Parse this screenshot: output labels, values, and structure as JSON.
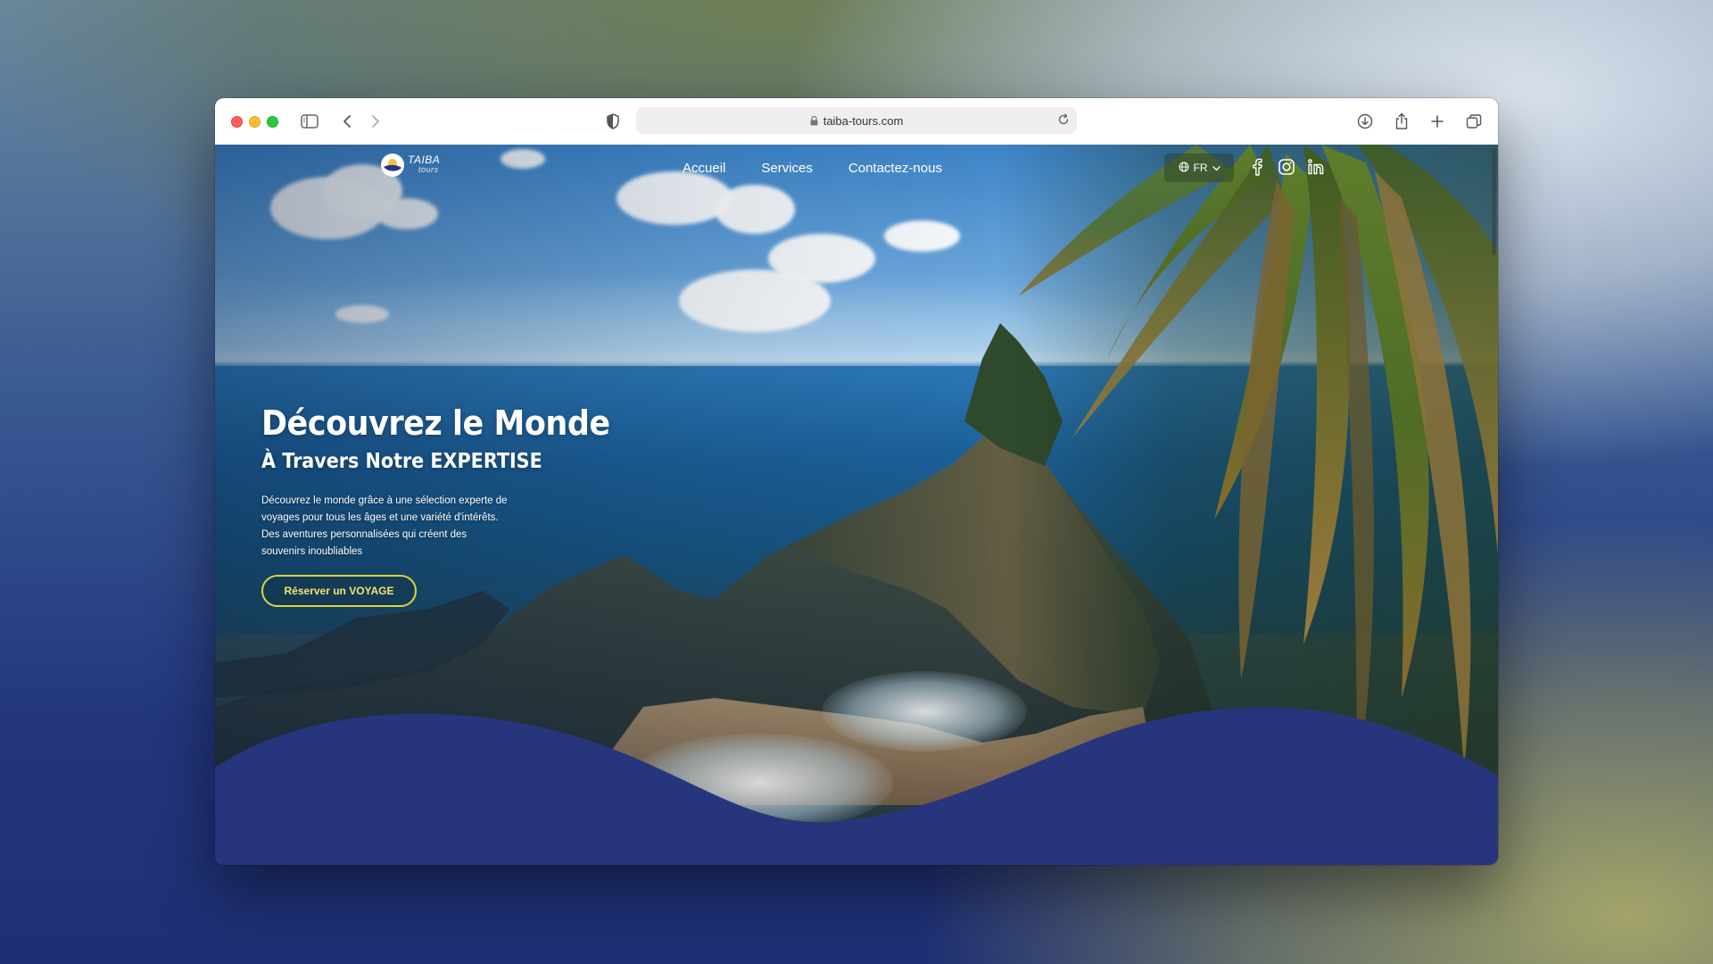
{
  "browser": {
    "url": "taiba-tours.com",
    "icons": {
      "sidebar": "sidebar-icon",
      "back": "chevron-left-icon",
      "forward": "chevron-right-icon",
      "shield": "shield-icon",
      "lock": "lock-icon",
      "reload": "reload-icon",
      "download": "download-icon",
      "share": "share-icon",
      "new_tab": "plus-icon",
      "tabs": "tabs-overview-icon"
    }
  },
  "site": {
    "logo": {
      "name": "TAIBA",
      "sub": "tours"
    },
    "nav": {
      "items": [
        {
          "label": "Accueil"
        },
        {
          "label": "Services"
        },
        {
          "label": "Contactez-nous"
        }
      ]
    },
    "language": {
      "selected": "FR"
    },
    "social": [
      "facebook-icon",
      "instagram-icon",
      "linkedin-icon"
    ]
  },
  "hero": {
    "title": "Découvrez le Monde",
    "subtitle": "À Travers Notre EXPERTISE",
    "text": "Découvrez le monde grâce à une sélection experte de voyages pour tous les âges et une variété d'intérêts. Des aventures personnalisées qui créent des souvenirs inoubliables",
    "cta_label": "Réserver un VOYAGE"
  },
  "colors": {
    "wave": "#27367c",
    "cta_border": "#e2d33a",
    "cta_text": "#f5e76a"
  }
}
